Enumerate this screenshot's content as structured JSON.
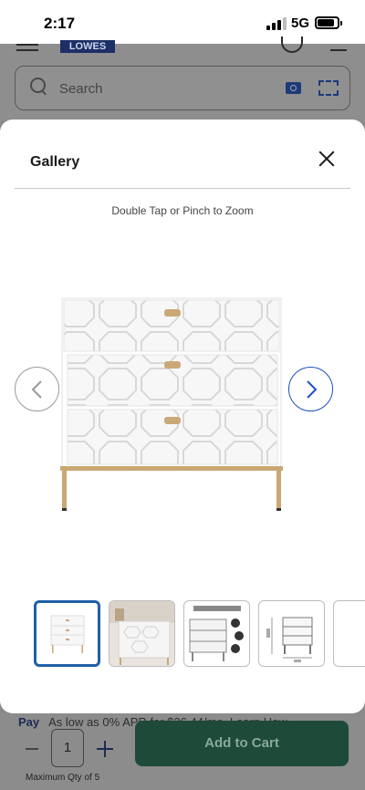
{
  "status_bar": {
    "time": "2:17",
    "network": "5G",
    "signal_bars_active": 3,
    "signal_bars_total": 4,
    "battery_level": 0.85
  },
  "background_page": {
    "logo_text": "LOWES",
    "search": {
      "placeholder": "Search"
    },
    "promo": {
      "brand": "Pay",
      "text": "As low as 0% APR for $26.44/mo. Learn How"
    },
    "quantity": {
      "value": "1",
      "max_label": "Maximum Qty of 5"
    },
    "add_to_cart_label": "Add to Cart",
    "icons": [
      "menu-icon",
      "user-icon",
      "cart-icon",
      "search-icon",
      "camera-icon",
      "barcode-scan-icon",
      "minus-icon",
      "plus-icon"
    ],
    "colors": {
      "brand_blue": "#012169",
      "cart_green": "#0b6b45"
    }
  },
  "gallery": {
    "title": "Gallery",
    "zoom_hint": "Double Tap or Pinch to Zoom",
    "main_image": "white-3-drawer-dresser-gold-legs",
    "icons": [
      "close-icon",
      "chevron-left-icon",
      "chevron-right-icon"
    ],
    "thumbnails": [
      {
        "image": "dresser-front-view",
        "selected": true
      },
      {
        "image": "dresser-room-scene",
        "selected": false
      },
      {
        "image": "dresser-assembly-diagram",
        "selected": false
      },
      {
        "image": "dresser-dimensions-diagram",
        "selected": false
      }
    ],
    "colors": {
      "selected_border": "#1f5fa8",
      "next_button": "#1f4fbf",
      "dresser_white": "#f4f4f4",
      "leg_gold": "#c9a873"
    }
  }
}
